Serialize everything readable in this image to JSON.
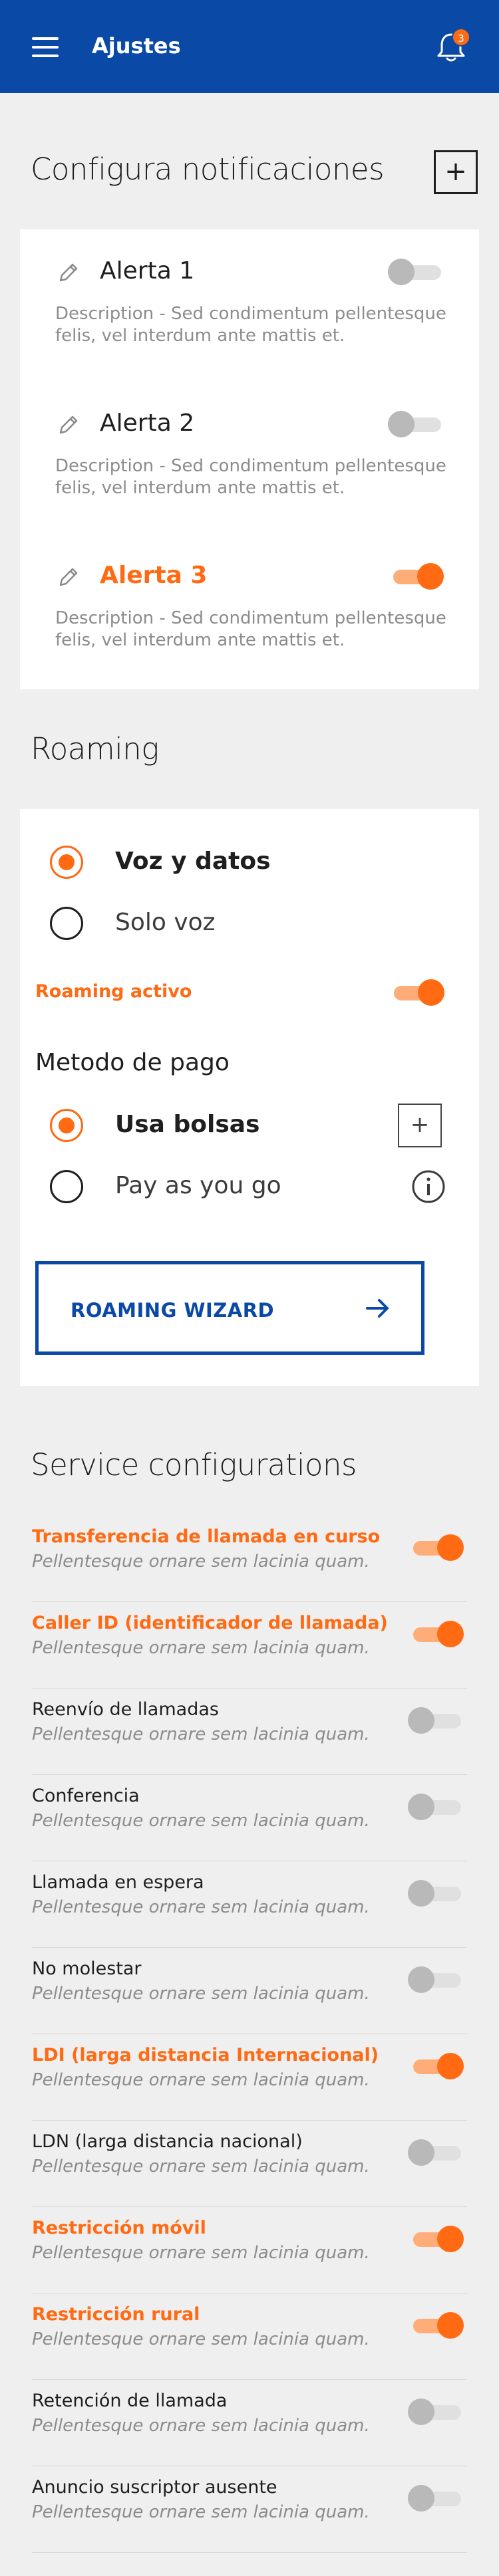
{
  "header": {
    "title": "Ajustes",
    "notification_count": "3"
  },
  "notifications": {
    "title": "Configura notificaciones",
    "alerts": [
      {
        "name": "Alerta 1",
        "description": "Description - Sed condimentum pellentesque felis, vel interdum ante mattis et.",
        "enabled": false
      },
      {
        "name": "Alerta 2",
        "description": "Description - Sed condimentum pellentesque felis, vel interdum ante mattis et.",
        "enabled": false
      },
      {
        "name": "Alerta 3",
        "description": "Description - Sed condimentum pellentesque felis, vel interdum ante mattis et.",
        "enabled": true
      }
    ]
  },
  "roaming": {
    "title": "Roaming",
    "options": [
      {
        "label": "Voz y datos",
        "selected": true
      },
      {
        "label": "Solo voz",
        "selected": false
      }
    ],
    "active_label": "Roaming activo",
    "active_enabled": true,
    "payment_title": "Metodo de pago",
    "payment_options": [
      {
        "label": "Usa bolsas",
        "selected": true
      },
      {
        "label": "Pay as you go",
        "selected": false
      }
    ],
    "wizard_label": "ROAMING WIZARD"
  },
  "services": {
    "title": "Service configurations",
    "subtitle_text": "Pellentesque ornare sem lacinia quam.",
    "items": [
      {
        "name": "Transferencia de llamada en curso",
        "subtitle": "Pellentesque ornare sem lacinia quam.",
        "enabled": true
      },
      {
        "name": "Caller ID (identificador de llamada)",
        "subtitle": "Pellentesque ornare sem lacinia quam.",
        "enabled": true
      },
      {
        "name": "Reenvío de llamadas",
        "subtitle": "Pellentesque ornare sem lacinia quam.",
        "enabled": false
      },
      {
        "name": "Conferencia",
        "subtitle": "Pellentesque ornare sem lacinia quam.",
        "enabled": false
      },
      {
        "name": "Llamada en espera",
        "subtitle": "Pellentesque ornare sem lacinia quam.",
        "enabled": false
      },
      {
        "name": "No molestar",
        "subtitle": "Pellentesque ornare sem lacinia quam.",
        "enabled": false
      },
      {
        "name": "LDI (larga distancia Internacional)",
        "subtitle": "Pellentesque ornare sem lacinia quam.",
        "enabled": true
      },
      {
        "name": "LDN (larga distancia nacional)",
        "subtitle": "Pellentesque ornare sem lacinia quam.",
        "enabled": false
      },
      {
        "name": "Restricción móvil",
        "subtitle": "Pellentesque ornare sem lacinia quam.",
        "enabled": true
      },
      {
        "name": "Restricción rural",
        "subtitle": "Pellentesque ornare sem lacinia quam.",
        "enabled": true
      },
      {
        "name": "Retención de llamada",
        "subtitle": "Pellentesque ornare sem lacinia quam.",
        "enabled": false
      },
      {
        "name": "Anuncio suscriptor ausente",
        "subtitle": "Pellentesque ornare sem lacinia quam.",
        "enabled": false
      }
    ]
  },
  "colors": {
    "brand_blue": "#0a4aa6",
    "accent_orange": "#ff6a13",
    "toggle_off": "#b9b9b9"
  }
}
